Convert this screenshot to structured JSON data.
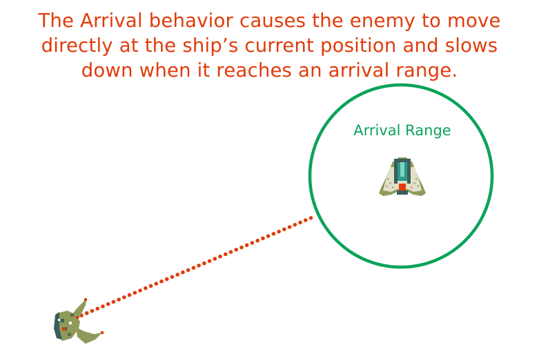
{
  "caption": {
    "lines": [
      "The Arrival behavior causes the enemy to move",
      "directly at the ship’s current position and slows",
      "down when it reaches an arrival range."
    ]
  },
  "arrival_range": {
    "label": "Arrival Range",
    "color": "#0aa35a"
  },
  "path": {
    "style": "dotted",
    "color": "#e03c0b"
  },
  "icons": {
    "ship": "player-ship-icon",
    "enemy": "enemy-ship-icon"
  },
  "colors": {
    "caption": "#e03c0b",
    "ship_hull": "#8f9a5a",
    "ship_dark": "#3a5e5e",
    "ship_teal": "#2a9a86",
    "ship_light": "#e4e0c8",
    "ship_red": "#e03c0b"
  }
}
